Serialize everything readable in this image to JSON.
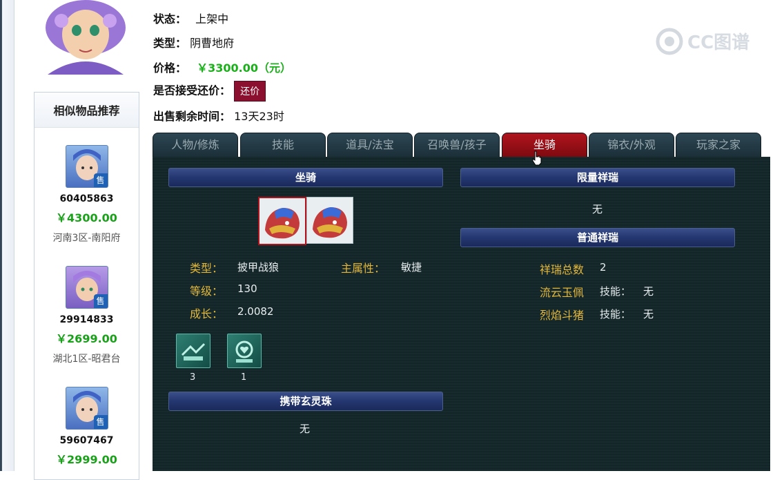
{
  "info": {
    "status_label": "状态：",
    "status_value": "上架中",
    "type_label": "类型：",
    "type_value": "阴曹地府",
    "price_label": "价格：",
    "price_value": "￥3300.00（元）",
    "bargain_label": "是否接受还价：",
    "bargain_button": "还价",
    "remaining_label": "出售剩余时间：",
    "remaining_value": "13天23时"
  },
  "watermark": "CC图谱",
  "sidebar": {
    "title": "相似物品推荐",
    "sale_badge": "售",
    "items": [
      {
        "id": "60405863",
        "price": "￥4300.00",
        "server": "河南3区-南阳府"
      },
      {
        "id": "29914833",
        "price": "￥2699.00",
        "server": "湖北1区-昭君台"
      },
      {
        "id": "59607467",
        "price": "￥2999.00",
        "server": ""
      }
    ]
  },
  "tabs": [
    {
      "label": "人物/修炼"
    },
    {
      "label": "技能"
    },
    {
      "label": "道具/法宝"
    },
    {
      "label": "召唤兽/孩子"
    },
    {
      "label": "坐骑",
      "active": true
    },
    {
      "label": "锦衣/外观"
    },
    {
      "label": "玩家之家"
    }
  ],
  "mount": {
    "section_title": "坐骑",
    "type_label": "类型：",
    "type_value": "披甲战狼",
    "main_attr_label": "主属性：",
    "main_attr_value": "敏捷",
    "level_label": "等级：",
    "level_value": "130",
    "growth_label": "成长：",
    "growth_value": "2.0082",
    "skills": [
      {
        "icon": "mount-skill-icon-1",
        "count": "3"
      },
      {
        "icon": "mount-skill-icon-2",
        "count": "1"
      }
    ],
    "orb_title": "携带玄灵珠",
    "orb_value": "无"
  },
  "limited": {
    "title": "限量祥瑞",
    "value": "无"
  },
  "normal": {
    "title": "普通祥瑞",
    "total_label": "祥瑞总数",
    "total_value": "2",
    "items": [
      {
        "name": "流云玉佩",
        "skill_label": "技能：",
        "skill_value": "无"
      },
      {
        "name": "烈焰斗猪",
        "skill_label": "技能：",
        "skill_value": "无"
      }
    ]
  },
  "colors": {
    "price_green": "#19b019",
    "active_tab": "#b0141d",
    "panel_bg": "#172a2c",
    "label_gold": "#e3b83a"
  }
}
